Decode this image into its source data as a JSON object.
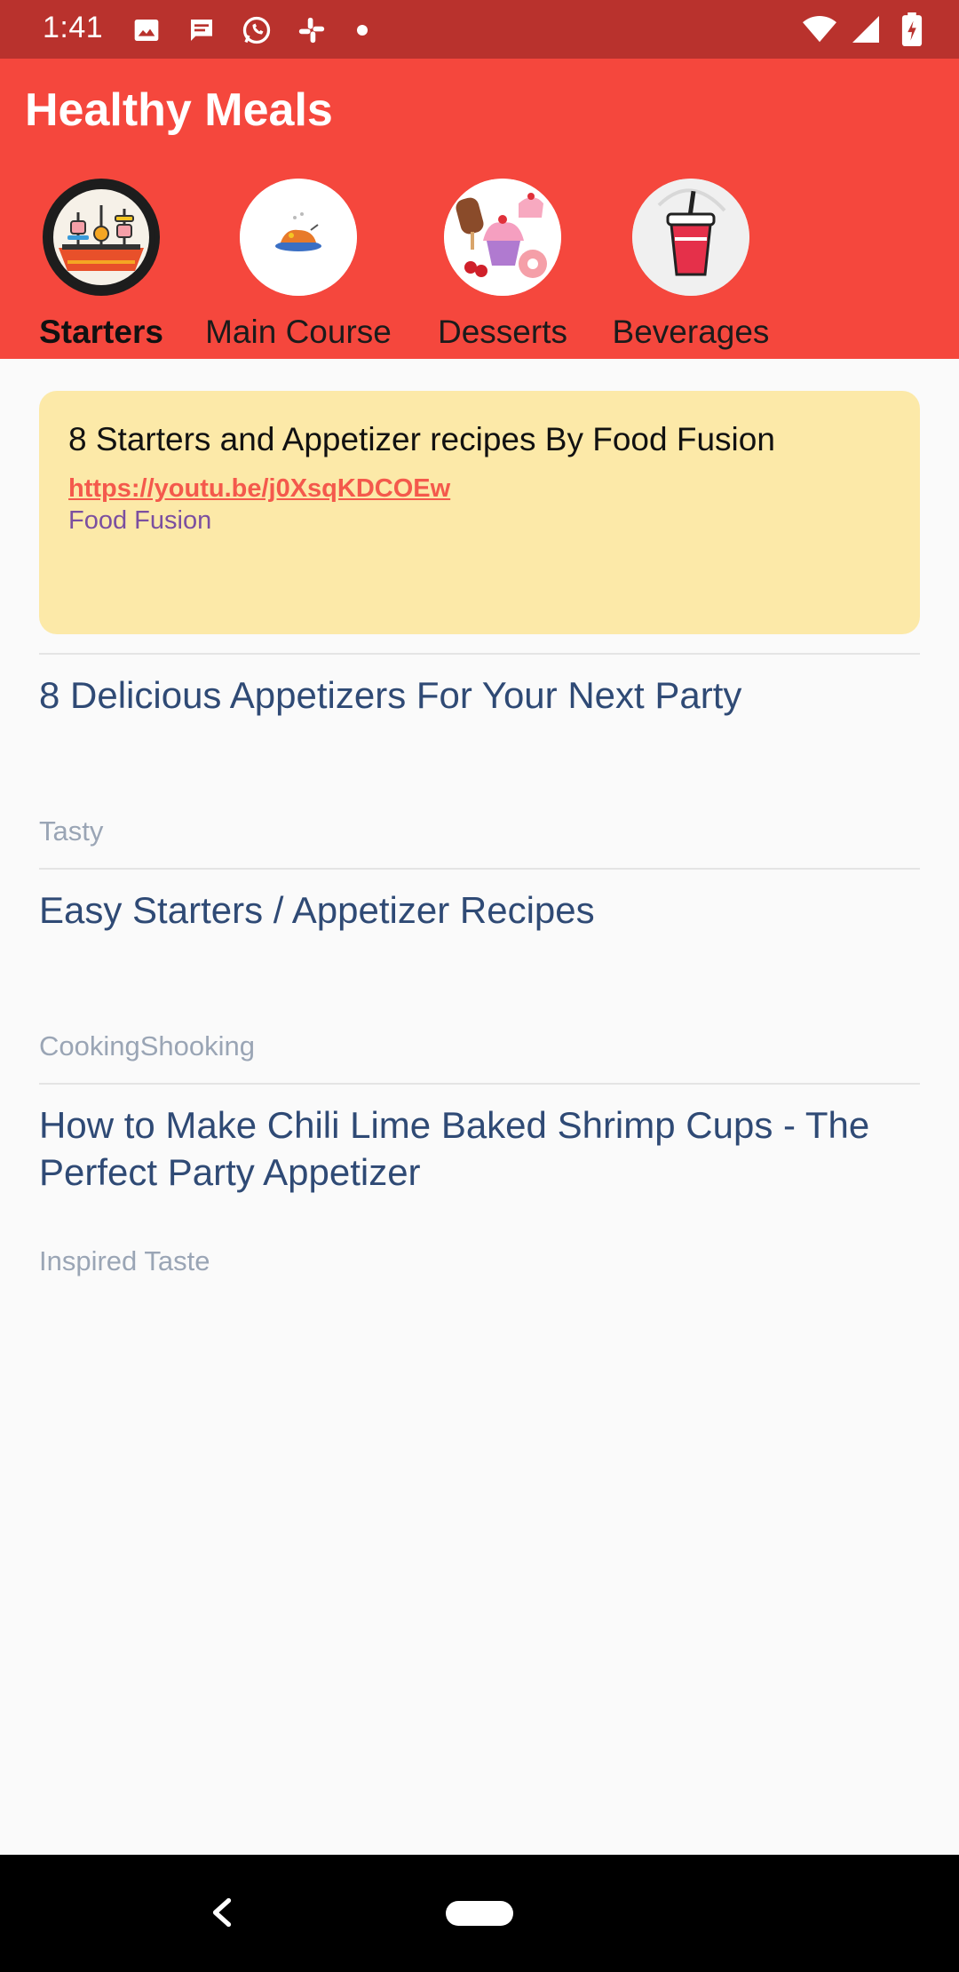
{
  "status_bar": {
    "time": "1:41",
    "left_icons": [
      "image-icon",
      "message-icon",
      "whatsapp-icon",
      "slack-icon",
      "dot-icon"
    ],
    "right_icons": [
      "wifi-icon",
      "signal-icon",
      "battery-charging-icon"
    ]
  },
  "app_bar": {
    "title": "Healthy Meals",
    "background": "#f5473d"
  },
  "categories": [
    {
      "label": "Starters",
      "icon": "starters-icon",
      "active": true
    },
    {
      "label": "Main Course",
      "icon": "main-course-icon",
      "active": false
    },
    {
      "label": "Desserts",
      "icon": "desserts-icon",
      "active": false
    },
    {
      "label": "Beverages",
      "icon": "beverages-icon",
      "active": false
    }
  ],
  "featured": {
    "title": "8 Starters and Appetizer recipes By Food Fusion",
    "link": "https://youtu.be/j0XsqKDCOEw",
    "channel": "Food Fusion",
    "background": "#fce9a8"
  },
  "videos": [
    {
      "title": "8 Delicious Appetizers For Your Next Party",
      "channel": "Tasty"
    },
    {
      "title": "Easy Starters / Appetizer Recipes",
      "channel": "CookingShooking"
    },
    {
      "title": "How to Make Chili Lime Baked Shrimp Cups - The Perfect Party Appetizer",
      "channel": "Inspired Taste"
    }
  ],
  "nav_bar": {
    "icons": [
      "back-icon",
      "home-pill-icon"
    ]
  }
}
